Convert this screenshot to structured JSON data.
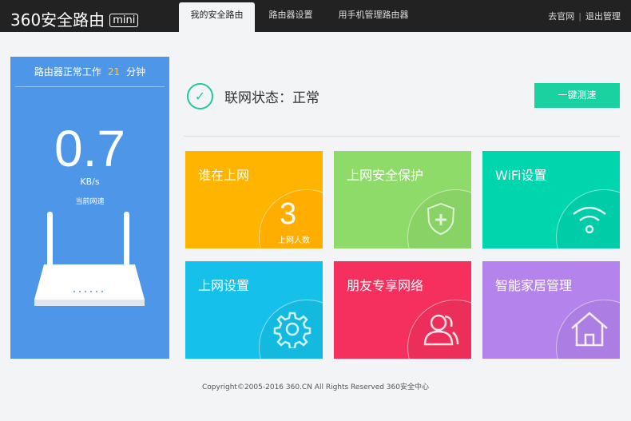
{
  "header": {
    "logo": "360安全路由",
    "logo_badge": "mini",
    "tabs": [
      {
        "label": "我的安全路由",
        "active": true
      },
      {
        "label": "路由器设置"
      },
      {
        "label": "用手机管理路由器"
      }
    ],
    "links": [
      "去官网",
      "退出管理"
    ]
  },
  "left": {
    "uptime_prefix": "路由器正常工作",
    "uptime_value": "21",
    "uptime_suffix": "分钟",
    "speed": "0.7",
    "unit": "KB/s",
    "speed_label": "当前网速"
  },
  "status": {
    "text": "联网状态：正常",
    "button": "一键测速"
  },
  "tiles": [
    {
      "title": "谁在上网",
      "count": "3",
      "count_label": "上网人数",
      "color": "#ffb400"
    },
    {
      "title": "上网安全保护",
      "icon": "shield-plus-icon",
      "color": "#8fdb6a"
    },
    {
      "title": "WiFi设置",
      "icon": "wifi-icon",
      "color": "#00d6ae"
    },
    {
      "title": "上网设置",
      "icon": "gear-icon",
      "color": "#15c1ea"
    },
    {
      "title": "朋友专享网络",
      "icon": "users-icon",
      "color": "#f5305e"
    },
    {
      "title": "智能家居管理",
      "icon": "home-icon",
      "color": "#b483ec"
    }
  ],
  "footer": "Copyright©2005-2016 360.CN All Rights Reserved 360安全中心"
}
